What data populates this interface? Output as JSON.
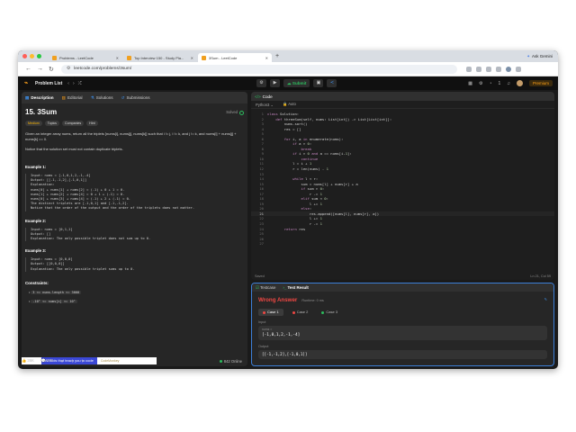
{
  "browser": {
    "tabs": [
      {
        "label": "Problems - LeetCode",
        "active": false
      },
      {
        "label": "Top Interview 150 - Study Pla...",
        "active": false
      },
      {
        "label": "3Sum - LeetCode",
        "active": true
      }
    ],
    "ask_gemini": "Ask Gemini",
    "url": "leetcode.com/problems/3sum/"
  },
  "lc_nav": {
    "problem_list": "Problem List",
    "submit": "Submit",
    "count": "1",
    "premium": "Premium"
  },
  "left_tabs": {
    "description": "Description",
    "editorial": "Editorial",
    "solutions": "Solutions",
    "submissions": "Submissions"
  },
  "problem": {
    "title": "15. 3Sum",
    "solved": "Solved",
    "tags": [
      "Medium",
      "Topics",
      "Companies",
      "Hint"
    ],
    "statement_1": "Given an integer array nums, return all the triplets [nums[i], nums[j], nums[k]] such that i != j, i != k, and j != k, and nums[i] + nums[j] + nums[k] == 0.",
    "statement_2": "Notice that the solution set must not contain duplicate triplets.",
    "example1_title": "Example 1:",
    "example1_body": "Input: nums = [-1,0,1,2,-1,-4]\nOutput: [[-1,-1,2],[-1,0,1]]\nExplanation:\nnums[0] + nums[1] + nums[2] = (-1) + 0 + 1 = 0.\nnums[1] + nums[2] + nums[4] = 0 + 1 + (-1) = 0.\nnums[0] + nums[3] + nums[4] = (-1) + 2 + (-1) = 0.\nThe distinct triplets are [-1,0,1] and [-1,-1,2].\nNotice that the order of the output and the order of the triplets does not matter.",
    "example2_title": "Example 2:",
    "example2_body": "Input: nums = [0,1,1]\nOutput: []\nExplanation: The only possible triplet does not sum up to 0.",
    "example3_title": "Example 3:",
    "example3_body": "Input: nums = [0,0,0]\nOutput: [[0,0,0]]\nExplanation: The only possible triplet sums up to 0.",
    "constraints_title": "Constraints:",
    "constraint_1": "3 <= nums.length <= 3000",
    "constraint_2": "-10⁵ <= nums[i] <= 10⁵"
  },
  "ad": {
    "text": "AI tools that teach you to code",
    "logo": "CodeMonkey"
  },
  "stats": {
    "likes": "36K",
    "comments": "879",
    "online": "842 Online"
  },
  "code": {
    "header": "Code",
    "language": "Python3",
    "autosave": "Auto",
    "lines": [
      "class Solution:",
      "    def threeSum(self, nums: List[int]) -> List[List[int]]:",
      "        nums.sort()",
      "        res = []",
      "",
      "        for i, a in enumerate(nums):",
      "            if a > 0:",
      "                break",
      "            if i > 0 and a == nums[i-1]:",
      "                continue",
      "            l = i + 1",
      "            r = len(nums) - 1",
      "",
      "            while l < r:",
      "                sum = nums[l] + nums[r] + a",
      "                if sum > 0:",
      "                    r -= 1",
      "                elif sum < 0:",
      "                    l += 1",
      "                else:",
      "                    res.append([nums[l], nums[r], a])",
      "                    l += 1",
      "                    r -= 1",
      "        return res",
      "",
      "",
      ""
    ],
    "highlight_line": 21,
    "footer_left": "Saved",
    "footer_right": "Ln 21, Col 59"
  },
  "test": {
    "testcase_tab": "Testcase",
    "result_tab": "Test Result",
    "verdict": "Wrong Answer",
    "runtime": "Runtime: 0 ms",
    "cases": [
      {
        "label": "Case 1",
        "color": "#ef4743"
      },
      {
        "label": "Case 2",
        "color": "#ef4743"
      },
      {
        "label": "Case 3",
        "color": "#2cbb5d"
      }
    ],
    "input_label": "Input",
    "input_key": "nums =",
    "input_value": "[-1,0,1,2,-1,-4]",
    "output_label": "Output",
    "output_value": "[[-1,-1,2],[-1,0,1]]"
  },
  "colors": {
    "accent": "#ffa116",
    "success": "#2cbb5d",
    "error": "#ef4743",
    "link": "#3c8ee8"
  }
}
